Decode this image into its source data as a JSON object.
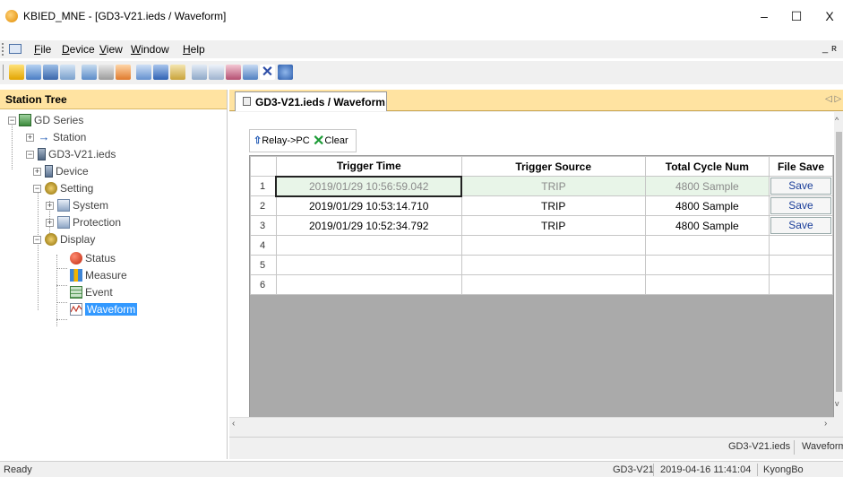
{
  "window": {
    "title": "KBIED_MNE - [GD3-V21.ieds / Waveform]",
    "minimize": "–",
    "maximize": "☐",
    "close": "X"
  },
  "menu": {
    "items": [
      "File",
      "Device",
      "View",
      "Window",
      "Help"
    ],
    "mdi_min": "_",
    "mdi_restore": "ʀ"
  },
  "toolbar": {
    "buttons": [
      "new-icon",
      "open-icon",
      "save-icon",
      "print-icon",
      "connect-icon",
      "disconnect-icon",
      "settings-icon",
      "upload-icon",
      "download-icon",
      "list-icon",
      "window-icon",
      "chart-icon",
      "edit-icon",
      "export-icon",
      "delete-icon",
      "help-icon"
    ]
  },
  "station_tree": {
    "header": "Station Tree",
    "nodes": {
      "gd_series": "GD Series",
      "station": "Station",
      "ieds": "GD3-V21.ieds",
      "device": "Device",
      "setting": "Setting",
      "system": "System",
      "protection": "Protection",
      "display": "Display",
      "status": "Status",
      "measure": "Measure",
      "event": "Event",
      "waveform": "Waveform"
    }
  },
  "document": {
    "tab_label": "GD3-V21.ieds / Waveform",
    "tab_nav": "◁ ▷",
    "relay_to_pc": "Relay->PC",
    "clear": "Clear",
    "columns": [
      "Trigger Time",
      "Trigger Source",
      "Total Cycle Num",
      "File Save"
    ],
    "rows": [
      {
        "num": "1",
        "time": "2019/01/29 10:56:59.042",
        "source": "TRIP",
        "cycles": "4800 Sample",
        "save": "Save"
      },
      {
        "num": "2",
        "time": "2019/01/29 10:53:14.710",
        "source": "TRIP",
        "cycles": "4800 Sample",
        "save": "Save"
      },
      {
        "num": "3",
        "time": "2019/01/29 10:52:34.792",
        "source": "TRIP",
        "cycles": "4800 Sample",
        "save": "Save"
      },
      {
        "num": "4",
        "time": "",
        "source": "",
        "cycles": "",
        "save": ""
      },
      {
        "num": "5",
        "time": "",
        "source": "",
        "cycles": "",
        "save": ""
      },
      {
        "num": "6",
        "time": "",
        "source": "",
        "cycles": "",
        "save": ""
      }
    ],
    "status_ieds": "GD3-V21.ieds",
    "status_view": "Waveform"
  },
  "statusbar": {
    "ready": "Ready",
    "device": "GD3-V21",
    "datetime": "2019-04-16 11:41:04",
    "user": "KyongBo"
  },
  "colors": {
    "panel_header": "#ffe3a1",
    "selection": "#3399ff",
    "highlight_row": "#e8f5e8",
    "save_text": "#1a3e9a"
  }
}
